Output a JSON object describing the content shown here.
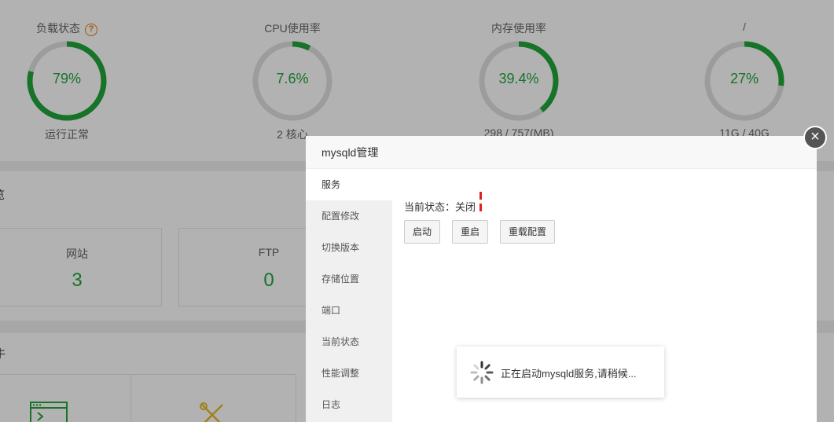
{
  "gauges": [
    {
      "title": "负载状态",
      "value": "79%",
      "sub": "运行正常",
      "percent": 79,
      "has_help": true
    },
    {
      "title": "CPU使用率",
      "value": "7.6%",
      "sub": "2 核心",
      "percent": 7.6,
      "has_help": false
    },
    {
      "title": "内存使用率",
      "value": "39.4%",
      "sub": "298 / 757(MB)",
      "percent": 39.4,
      "has_help": false
    },
    {
      "title": "/",
      "value": "27%",
      "sub": "11G / 40G",
      "percent": 27,
      "has_help": false
    }
  ],
  "help_icon_text": "?",
  "overview": {
    "title": "览",
    "stats": [
      {
        "label": "网站",
        "value": "3"
      },
      {
        "label": "FTP",
        "value": "0"
      }
    ]
  },
  "software": {
    "title": "牛"
  },
  "modal": {
    "title": "mysqld管理",
    "close_glyph": "×",
    "sidebar": [
      {
        "label": "服务",
        "active": true
      },
      {
        "label": "配置修改"
      },
      {
        "label": "切换版本"
      },
      {
        "label": "存储位置"
      },
      {
        "label": "端口"
      },
      {
        "label": "当前状态"
      },
      {
        "label": "性能调整"
      },
      {
        "label": "日志"
      }
    ],
    "status_label": "当前状态：关闭",
    "buttons": {
      "start": "启动",
      "restart": "重启",
      "reload": "重载配置"
    }
  },
  "loading": {
    "text": "正在启动mysqld服务,请稍候..."
  },
  "colors": {
    "accent": "#20a53a",
    "gauge_track": "#e0e0e0",
    "stop_icon": "#e02020",
    "help": "#e8790a"
  }
}
